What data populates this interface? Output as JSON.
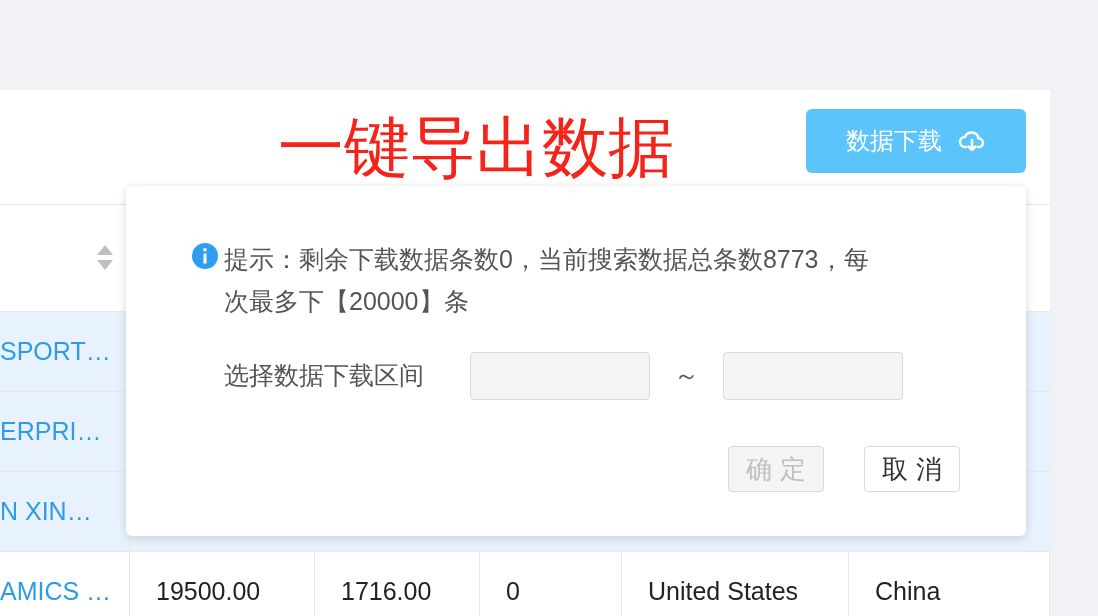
{
  "annotation": "一键导出数据",
  "download_button": {
    "label": "数据下载"
  },
  "table": {
    "rows": [
      {
        "selected": true,
        "cells": [
          "SPORT…"
        ]
      },
      {
        "selected": true,
        "cells": [
          "ERPRI…"
        ]
      },
      {
        "selected": true,
        "cells": [
          "N XIN…"
        ]
      },
      {
        "selected": false,
        "cells": [
          "AMICS …",
          "19500.00",
          "1716.00",
          "0",
          "United States",
          "China"
        ]
      }
    ]
  },
  "popover": {
    "notice": "提示：剩余下载数据条数0，当前搜索数据总条数8773，每次最多下【20000】条",
    "range_label": "选择数据下载区间",
    "separator": "～",
    "confirm": {
      "label": "确 定",
      "disabled": true
    },
    "cancel": {
      "label": "取 消",
      "disabled": false
    }
  }
}
